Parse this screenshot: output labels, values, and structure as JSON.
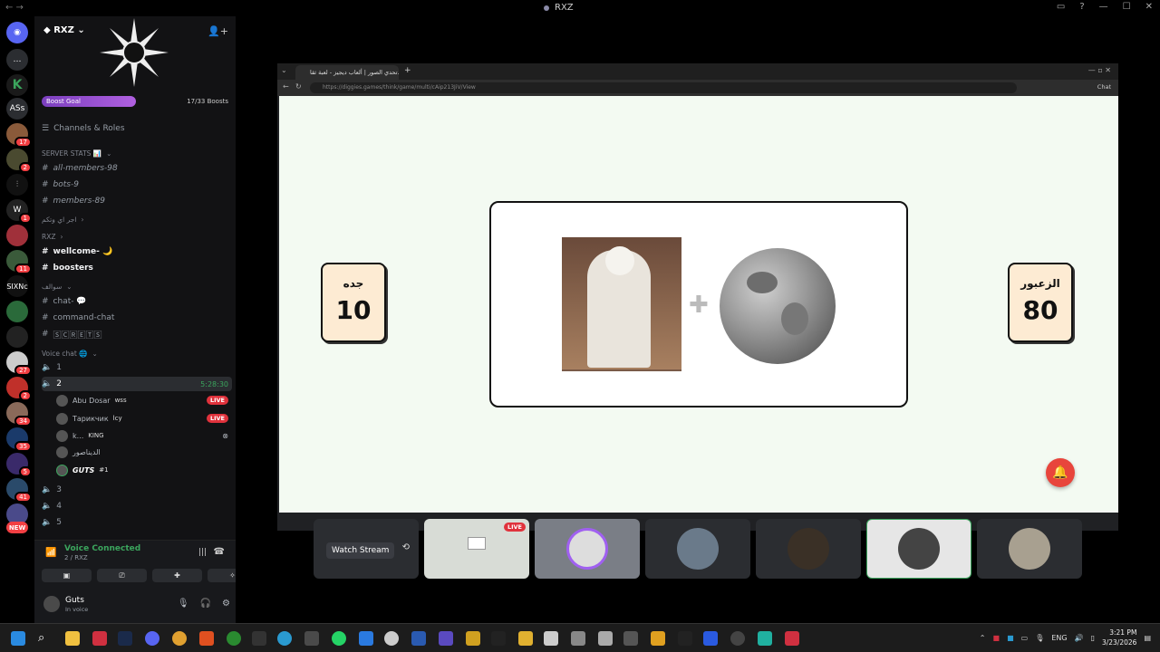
{
  "window": {
    "title": "RXZ"
  },
  "server": {
    "name": "RXZ",
    "boost_label": "Boost Goal",
    "boost_count": "17/33 Boosts",
    "boost_progress": 0.52,
    "channels_roles": "Channels & Roles"
  },
  "guild_badges": [
    "17",
    "2",
    "1",
    "11",
    "27",
    "2",
    "34",
    "35",
    "5",
    "41",
    "NEW"
  ],
  "guild_labels": {
    "ass": "ASs",
    "sixnc": "SIXNc"
  },
  "channels": {
    "cat_stats": "SERVER STATS 📊",
    "all_members": "all-members-98",
    "bots": "bots-9",
    "members": "members-89",
    "cat_arabic1": "اجر اي وتكم",
    "cat_rxz": "RXZ",
    "wellcome": "wellcome- 🌙",
    "boosters": "boosters",
    "cat_arabic2": "سوالف",
    "chat": "chat- 💬",
    "command_chat": "command-chat",
    "secret": "🅂🄲🅁🄴🅃🅂",
    "cat_voice": "Voice chat 🌐",
    "vc1": "1",
    "vc2": "2",
    "vc2_time": "5:28:30",
    "vc3": "3",
    "vc4": "4",
    "vc5": "5"
  },
  "voice_users": [
    {
      "name": "Abu Dosar",
      "tag": "wss",
      "live": "LIVE"
    },
    {
      "name": "Тарикчик",
      "tag": "lcy",
      "live": "LIVE"
    },
    {
      "name": "k...",
      "tag": "KING",
      "live": ""
    },
    {
      "name": "الديناصور",
      "tag": "",
      "live": ""
    },
    {
      "name": "GUTS",
      "tag": "#1",
      "live": ""
    }
  ],
  "voice_panel": {
    "title": "Voice Connected",
    "sub": "2 / RXZ"
  },
  "user": {
    "name": "Guts",
    "status": "In voice"
  },
  "browser": {
    "tab_title": "تحدي الصور | ألعاب ديجيز - لعبة ثقا...",
    "url": "https://diggies.games/think/game/multi/cAip213JiV/View",
    "chat_label": "Chat"
  },
  "game": {
    "left_team": {
      "name": "جده",
      "score": "10"
    },
    "right_team": {
      "name": "الزعبور",
      "score": "80"
    }
  },
  "tiles": {
    "watch": "Watch Stream",
    "live": "LIVE"
  },
  "taskbar": {
    "lang": "ENG",
    "time": "3:21 PM",
    "date": "3/23/2026"
  }
}
